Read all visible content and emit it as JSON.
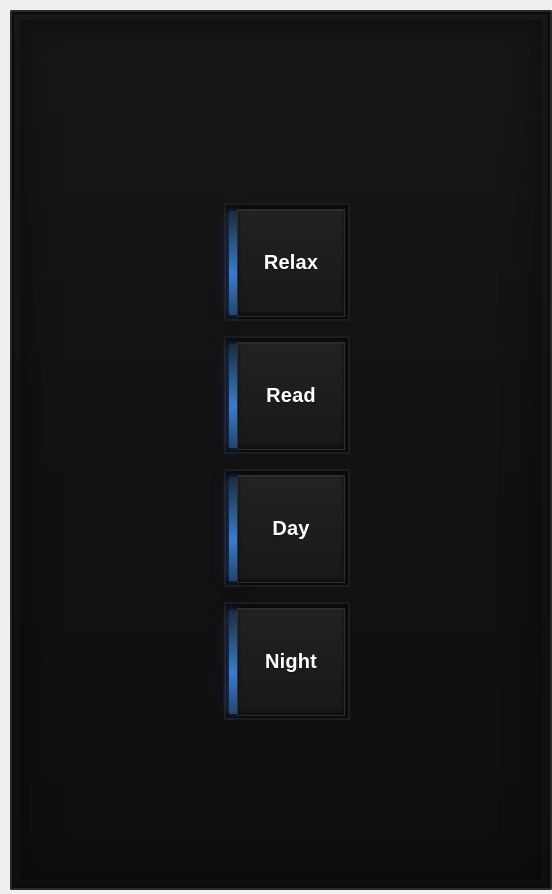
{
  "keypad": {
    "led_color": "#3b7bd0",
    "buttons": [
      {
        "label": "Relax"
      },
      {
        "label": "Read"
      },
      {
        "label": "Day"
      },
      {
        "label": "Night"
      }
    ]
  }
}
